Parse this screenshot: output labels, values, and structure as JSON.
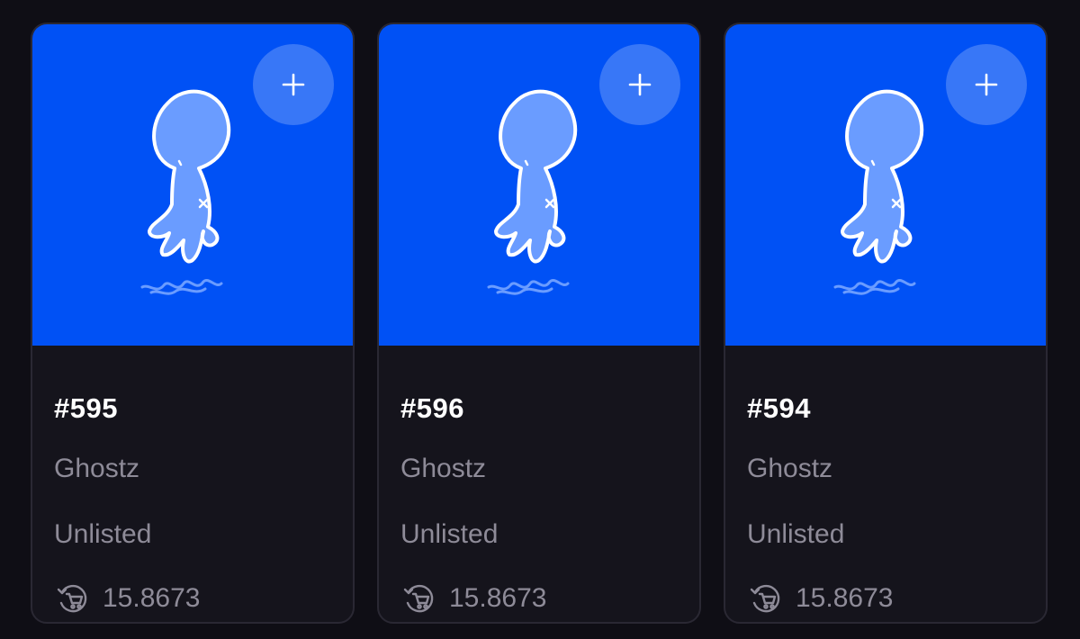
{
  "colors": {
    "page_background": "#0f0e15",
    "card_background": "#15141c",
    "card_border": "#2a2833",
    "media_background": "#0051f5",
    "title_text": "#ffffff",
    "secondary_text": "#8e8b98"
  },
  "cards": [
    {
      "token_id": "#595",
      "collection": "Ghostz",
      "status": "Unlisted",
      "price": "15.8673",
      "add_icon": "plus-icon",
      "price_icon": "cart-refresh-icon"
    },
    {
      "token_id": "#596",
      "collection": "Ghostz",
      "status": "Unlisted",
      "price": "15.8673",
      "add_icon": "plus-icon",
      "price_icon": "cart-refresh-icon"
    },
    {
      "token_id": "#594",
      "collection": "Ghostz",
      "status": "Unlisted",
      "price": "15.8673",
      "add_icon": "plus-icon",
      "price_icon": "cart-refresh-icon"
    }
  ]
}
